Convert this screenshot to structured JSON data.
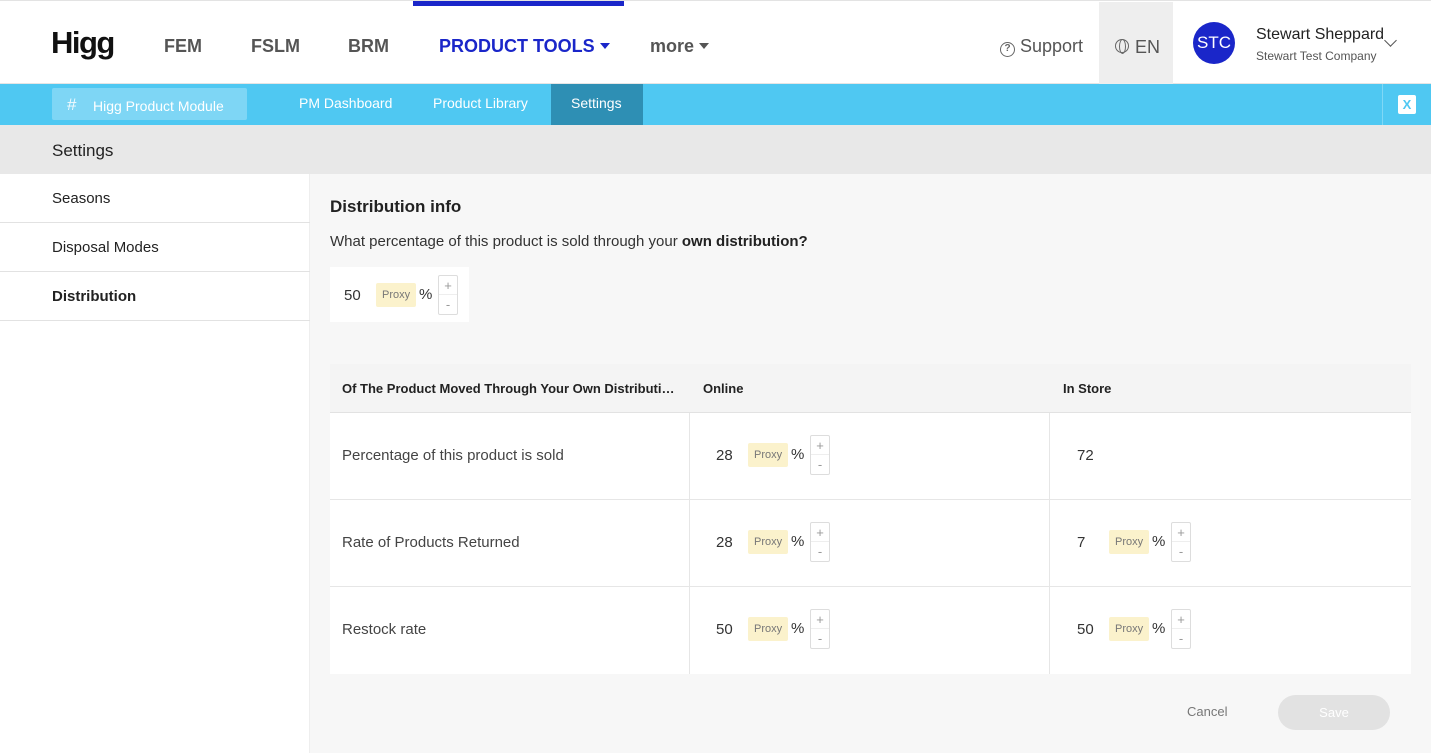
{
  "brand": {
    "logo": "Higg",
    "accent": "#1a26c9",
    "sub_accent": "#4fc8f2"
  },
  "topnav": {
    "items": [
      "FEM",
      "FSLM",
      "BRM",
      "PRODUCT TOOLS",
      "more"
    ],
    "active": "PRODUCT TOOLS",
    "support": "Support",
    "language": "EN",
    "avatar_initials": "STC",
    "user_name": "Stewart Sheppard",
    "user_company": "Stewart Test Company"
  },
  "subnav": {
    "module": "Higg Product Module",
    "items": [
      "PM Dashboard",
      "Product Library",
      "Settings"
    ],
    "active": "Settings",
    "excel_icon": "excel-export-icon",
    "excel_glyph": "X"
  },
  "page": {
    "title": "Settings"
  },
  "sidebar": {
    "items": [
      {
        "label": "Seasons"
      },
      {
        "label": "Disposal Modes"
      },
      {
        "label": "Distribution"
      }
    ],
    "active": "Distribution"
  },
  "distribution": {
    "title": "Distribution info",
    "question_prefix": "What percentage of this product is sold through your ",
    "question_bold": "own distribution?",
    "own_value": "50",
    "proxy_label": "Proxy",
    "pct_symbol": "%",
    "plus": "+",
    "minus": "-"
  },
  "table": {
    "headers": [
      "Of The Product Moved Through Your Own Distribution",
      "Online",
      "In Store"
    ],
    "rows": [
      {
        "label": "Percentage of this product is sold",
        "online": "28",
        "instore": "72"
      },
      {
        "label": "Rate of Products Returned",
        "online": "28",
        "instore": "7"
      },
      {
        "label": "Restock rate",
        "online": "50",
        "instore": "50"
      }
    ]
  },
  "actions": {
    "cancel": "Cancel",
    "save": "Save"
  }
}
